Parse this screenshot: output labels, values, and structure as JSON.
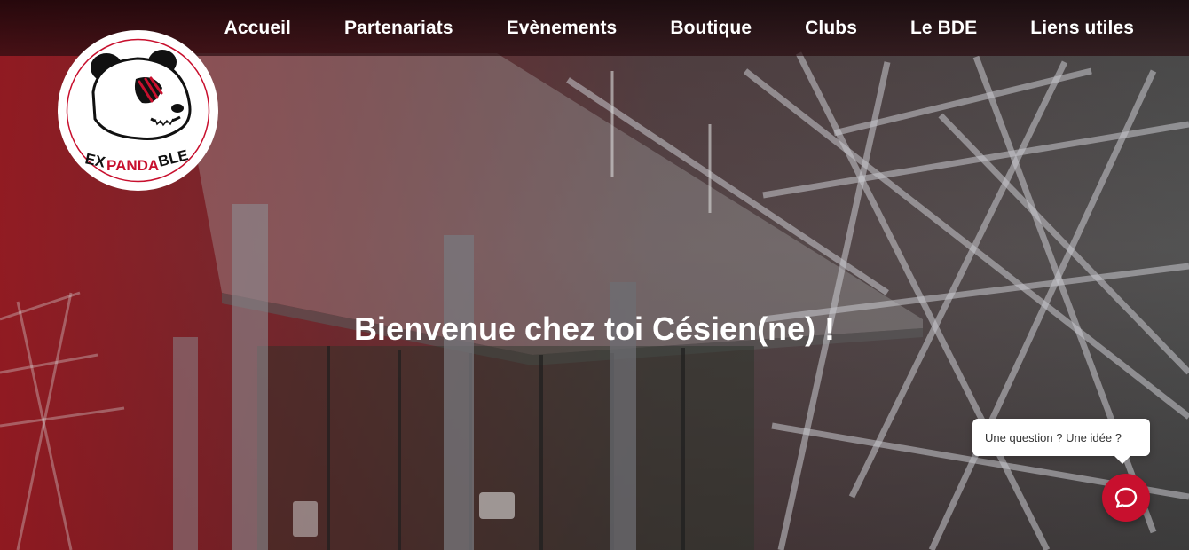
{
  "nav": {
    "items": [
      {
        "label": "Accueil"
      },
      {
        "label": "Partenariats"
      },
      {
        "label": "Evènements"
      },
      {
        "label": "Boutique"
      },
      {
        "label": "Clubs"
      },
      {
        "label": "Le BDE"
      },
      {
        "label": "Liens utiles"
      }
    ]
  },
  "logo": {
    "text_ex": "EX",
    "text_panda": "PANDA",
    "text_ble": "BLE",
    "icon": "panda-mascot-icon"
  },
  "hero": {
    "title": "Bienvenue chez toi Césien(ne) !",
    "background_icon": "campus-building-photo"
  },
  "chat": {
    "prompt": "Une question ? Une idée ?",
    "icon": "chat-bubble-icon"
  },
  "colors": {
    "brand_red": "#c8102e",
    "nav_text": "#ffffff"
  }
}
